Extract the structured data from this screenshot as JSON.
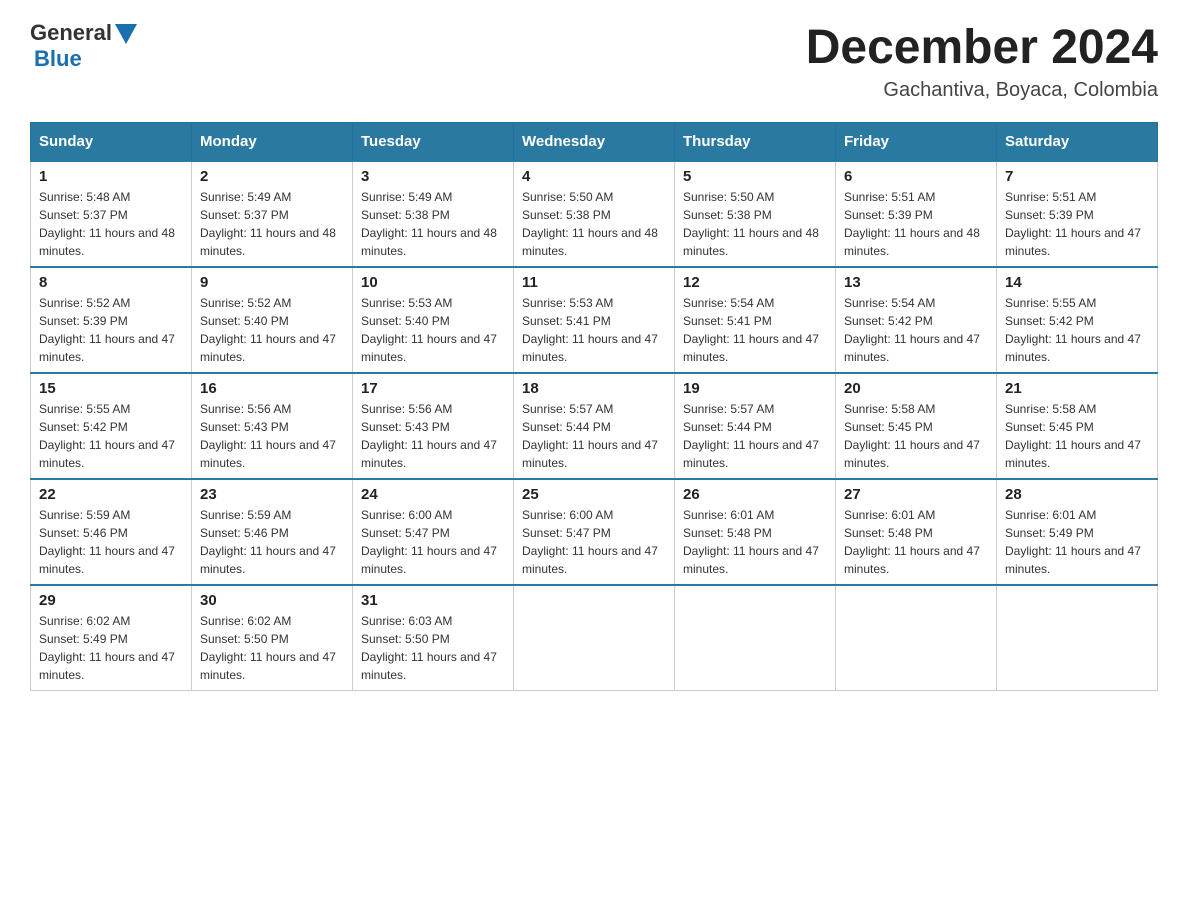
{
  "header": {
    "logo": {
      "text_general": "General",
      "text_blue": "Blue",
      "aria": "GeneralBlue logo"
    },
    "month_title": "December 2024",
    "location": "Gachantiva, Boyaca, Colombia"
  },
  "weekdays": [
    "Sunday",
    "Monday",
    "Tuesday",
    "Wednesday",
    "Thursday",
    "Friday",
    "Saturday"
  ],
  "weeks": [
    [
      {
        "day": "1",
        "sunrise": "Sunrise: 5:48 AM",
        "sunset": "Sunset: 5:37 PM",
        "daylight": "Daylight: 11 hours and 48 minutes."
      },
      {
        "day": "2",
        "sunrise": "Sunrise: 5:49 AM",
        "sunset": "Sunset: 5:37 PM",
        "daylight": "Daylight: 11 hours and 48 minutes."
      },
      {
        "day": "3",
        "sunrise": "Sunrise: 5:49 AM",
        "sunset": "Sunset: 5:38 PM",
        "daylight": "Daylight: 11 hours and 48 minutes."
      },
      {
        "day": "4",
        "sunrise": "Sunrise: 5:50 AM",
        "sunset": "Sunset: 5:38 PM",
        "daylight": "Daylight: 11 hours and 48 minutes."
      },
      {
        "day": "5",
        "sunrise": "Sunrise: 5:50 AM",
        "sunset": "Sunset: 5:38 PM",
        "daylight": "Daylight: 11 hours and 48 minutes."
      },
      {
        "day": "6",
        "sunrise": "Sunrise: 5:51 AM",
        "sunset": "Sunset: 5:39 PM",
        "daylight": "Daylight: 11 hours and 48 minutes."
      },
      {
        "day": "7",
        "sunrise": "Sunrise: 5:51 AM",
        "sunset": "Sunset: 5:39 PM",
        "daylight": "Daylight: 11 hours and 47 minutes."
      }
    ],
    [
      {
        "day": "8",
        "sunrise": "Sunrise: 5:52 AM",
        "sunset": "Sunset: 5:39 PM",
        "daylight": "Daylight: 11 hours and 47 minutes."
      },
      {
        "day": "9",
        "sunrise": "Sunrise: 5:52 AM",
        "sunset": "Sunset: 5:40 PM",
        "daylight": "Daylight: 11 hours and 47 minutes."
      },
      {
        "day": "10",
        "sunrise": "Sunrise: 5:53 AM",
        "sunset": "Sunset: 5:40 PM",
        "daylight": "Daylight: 11 hours and 47 minutes."
      },
      {
        "day": "11",
        "sunrise": "Sunrise: 5:53 AM",
        "sunset": "Sunset: 5:41 PM",
        "daylight": "Daylight: 11 hours and 47 minutes."
      },
      {
        "day": "12",
        "sunrise": "Sunrise: 5:54 AM",
        "sunset": "Sunset: 5:41 PM",
        "daylight": "Daylight: 11 hours and 47 minutes."
      },
      {
        "day": "13",
        "sunrise": "Sunrise: 5:54 AM",
        "sunset": "Sunset: 5:42 PM",
        "daylight": "Daylight: 11 hours and 47 minutes."
      },
      {
        "day": "14",
        "sunrise": "Sunrise: 5:55 AM",
        "sunset": "Sunset: 5:42 PM",
        "daylight": "Daylight: 11 hours and 47 minutes."
      }
    ],
    [
      {
        "day": "15",
        "sunrise": "Sunrise: 5:55 AM",
        "sunset": "Sunset: 5:42 PM",
        "daylight": "Daylight: 11 hours and 47 minutes."
      },
      {
        "day": "16",
        "sunrise": "Sunrise: 5:56 AM",
        "sunset": "Sunset: 5:43 PM",
        "daylight": "Daylight: 11 hours and 47 minutes."
      },
      {
        "day": "17",
        "sunrise": "Sunrise: 5:56 AM",
        "sunset": "Sunset: 5:43 PM",
        "daylight": "Daylight: 11 hours and 47 minutes."
      },
      {
        "day": "18",
        "sunrise": "Sunrise: 5:57 AM",
        "sunset": "Sunset: 5:44 PM",
        "daylight": "Daylight: 11 hours and 47 minutes."
      },
      {
        "day": "19",
        "sunrise": "Sunrise: 5:57 AM",
        "sunset": "Sunset: 5:44 PM",
        "daylight": "Daylight: 11 hours and 47 minutes."
      },
      {
        "day": "20",
        "sunrise": "Sunrise: 5:58 AM",
        "sunset": "Sunset: 5:45 PM",
        "daylight": "Daylight: 11 hours and 47 minutes."
      },
      {
        "day": "21",
        "sunrise": "Sunrise: 5:58 AM",
        "sunset": "Sunset: 5:45 PM",
        "daylight": "Daylight: 11 hours and 47 minutes."
      }
    ],
    [
      {
        "day": "22",
        "sunrise": "Sunrise: 5:59 AM",
        "sunset": "Sunset: 5:46 PM",
        "daylight": "Daylight: 11 hours and 47 minutes."
      },
      {
        "day": "23",
        "sunrise": "Sunrise: 5:59 AM",
        "sunset": "Sunset: 5:46 PM",
        "daylight": "Daylight: 11 hours and 47 minutes."
      },
      {
        "day": "24",
        "sunrise": "Sunrise: 6:00 AM",
        "sunset": "Sunset: 5:47 PM",
        "daylight": "Daylight: 11 hours and 47 minutes."
      },
      {
        "day": "25",
        "sunrise": "Sunrise: 6:00 AM",
        "sunset": "Sunset: 5:47 PM",
        "daylight": "Daylight: 11 hours and 47 minutes."
      },
      {
        "day": "26",
        "sunrise": "Sunrise: 6:01 AM",
        "sunset": "Sunset: 5:48 PM",
        "daylight": "Daylight: 11 hours and 47 minutes."
      },
      {
        "day": "27",
        "sunrise": "Sunrise: 6:01 AM",
        "sunset": "Sunset: 5:48 PM",
        "daylight": "Daylight: 11 hours and 47 minutes."
      },
      {
        "day": "28",
        "sunrise": "Sunrise: 6:01 AM",
        "sunset": "Sunset: 5:49 PM",
        "daylight": "Daylight: 11 hours and 47 minutes."
      }
    ],
    [
      {
        "day": "29",
        "sunrise": "Sunrise: 6:02 AM",
        "sunset": "Sunset: 5:49 PM",
        "daylight": "Daylight: 11 hours and 47 minutes."
      },
      {
        "day": "30",
        "sunrise": "Sunrise: 6:02 AM",
        "sunset": "Sunset: 5:50 PM",
        "daylight": "Daylight: 11 hours and 47 minutes."
      },
      {
        "day": "31",
        "sunrise": "Sunrise: 6:03 AM",
        "sunset": "Sunset: 5:50 PM",
        "daylight": "Daylight: 11 hours and 47 minutes."
      },
      null,
      null,
      null,
      null
    ]
  ]
}
